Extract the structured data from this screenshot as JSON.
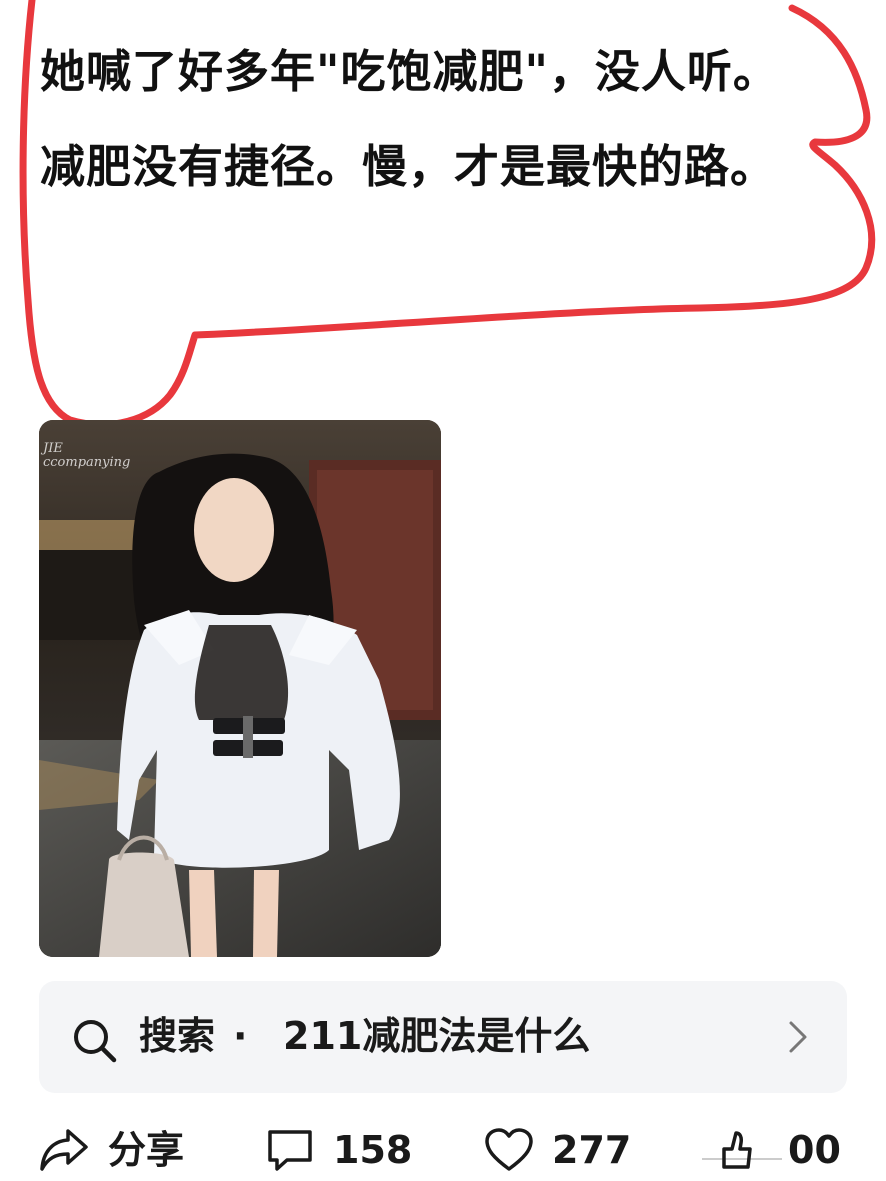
{
  "post": {
    "line1": "她喊了好多年\"吃饱减肥\"，没人听。",
    "line2": "减肥没有捷径。慢，才是最快的路。"
  },
  "image": {
    "watermark_line1": "JIE",
    "watermark_line2": "ccompanying"
  },
  "search": {
    "prefix": "搜索",
    "separator": "·",
    "query": "211减肥法是什么",
    "icon": "search-icon",
    "chevron": "chevron-right-icon"
  },
  "actions": {
    "share_label": "分享",
    "comment_count": "158",
    "like_count": "277",
    "partial_count": "00"
  },
  "colors": {
    "scribble": "#e8383d",
    "search_bg": "#f4f5f7",
    "text": "#111111"
  }
}
